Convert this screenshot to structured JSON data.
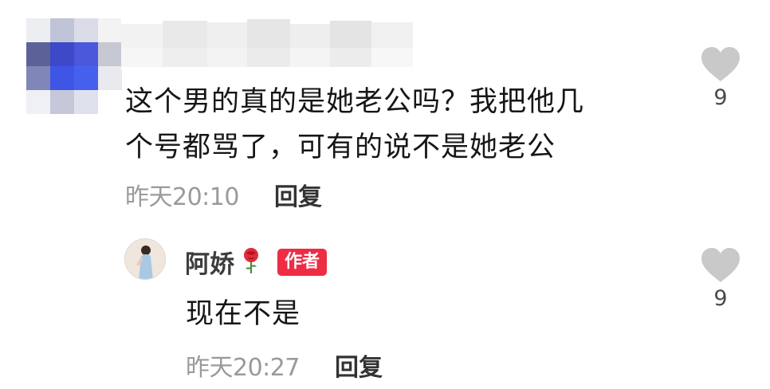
{
  "comment": {
    "text_line1": "这个男的真的是她老公吗？我把他几",
    "text_line2": "个号都骂了，可有的说不是她老公",
    "time": "昨天20:10",
    "reply_label": "回复",
    "likes": "9"
  },
  "reply": {
    "author": "阿娇",
    "author_badge": "作者",
    "text": "现在不是",
    "time": "昨天20:27",
    "reply_label": "回复",
    "likes": "9"
  },
  "colors": {
    "badge": "#ee2c44",
    "heart": "#c9c9c9",
    "time_text": "#9a9a9a"
  }
}
